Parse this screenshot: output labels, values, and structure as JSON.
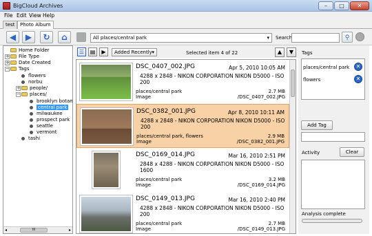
{
  "window": {
    "title": "BigCloud Archives",
    "minimize": "–",
    "maximize": "□",
    "close": "✕"
  },
  "menu": [
    "File",
    "Edit",
    "View",
    "Help"
  ],
  "tabs": [
    "test",
    "Photo Album"
  ],
  "toolbar": {
    "location": "All places/central park",
    "search_label": "Search",
    "search_value": ""
  },
  "tree": {
    "items": [
      "Home Folder",
      "File Type",
      "Date Created",
      "Tags",
      "flowers",
      "norbu",
      "people/",
      "places/",
      "brooklyn botanica",
      "central park",
      "milwaukee",
      "prospect park",
      "seattle",
      "vermont",
      "tashi"
    ],
    "selected": "central park",
    "scroll_label": "III"
  },
  "list_header": {
    "sort": "Added Recently",
    "selection": "Selected item 4 of 22"
  },
  "items": [
    {
      "name": "DSC_0407_002.JPG",
      "date": "Apr 5, 2010 10:05 AM",
      "info": "4288 x 2848 - NIKON CORPORATION NIKON D5000 - ISO 200",
      "tags": "places/central park",
      "type": "Image",
      "size": "2.7 MB",
      "path": "/DSC_0407_002.JPG"
    },
    {
      "name": "DSC_0382_001.JPG",
      "date": "Apr 8, 2010 10:11 AM",
      "info": "4288 x 2848 - NIKON CORPORATION NIKON D5000 - ISO 200",
      "tags": "places/central park, flowers",
      "type": "Image",
      "size": "2.9 MB",
      "path": "/DSC_0382_001.JPG"
    },
    {
      "name": "DSC_0169_014.JPG",
      "date": "Mar 16, 2010 2:51 PM",
      "info": "2848 x 4288 - NIKON CORPORATION NIKON D5000 - ISO 1600",
      "tags": "places/central park",
      "type": "Image",
      "size": "3.2 MB",
      "path": "/DSC_0169_014.JPG"
    },
    {
      "name": "DSC_0149_013.JPG",
      "date": "Mar 16, 2010 2:40 PM",
      "info": "4288 x 2848 - NIKON CORPORATION NIKON D5000 - ISO 200",
      "tags": "places/central park",
      "type": "Image",
      "size": "2.7 MB",
      "path": "/DSC_0149_013.JPG"
    }
  ],
  "right_panel": {
    "tags_label": "Tags",
    "tags": [
      "places/central park",
      "flowers"
    ],
    "add_tag": "Add Tag",
    "activity_label": "Activity",
    "clear": "Clear",
    "status": "Analysis complete"
  },
  "colors": {
    "accent": "#2a66c9",
    "selection": "#f8d2a6"
  },
  "icons": [
    "back-icon",
    "forward-icon",
    "refresh-icon",
    "home-icon",
    "search-icon",
    "folder-icon",
    "tag-remove-icon"
  ]
}
